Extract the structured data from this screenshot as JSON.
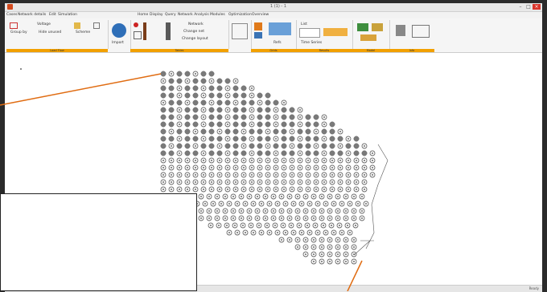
{
  "window": {
    "title": "1 (1) - 1",
    "minimize_icon": "minimize-icon",
    "maximize_icon": "maximize-icon",
    "close_icon": "close-icon"
  },
  "menu": [
    {
      "label": "Cases"
    },
    {
      "label": "Network details"
    },
    {
      "label": "Edit"
    },
    {
      "label": "Simulation"
    },
    {
      "label": "Home"
    },
    {
      "label": "Display"
    },
    {
      "label": "Query"
    },
    {
      "label": "Network Analysis"
    },
    {
      "label": "Modules"
    },
    {
      "label": "Optimization"
    },
    {
      "label": "Overview"
    }
  ],
  "ribbon": {
    "toolbar1": {
      "label1": "Voltage",
      "label2": "Group by",
      "label3": "Hide unused",
      "label4": "Scheme"
    },
    "import_label": "Import",
    "groups": [
      {
        "label": "Load Flow",
        "color": "#f2a000"
      },
      {
        "label": "Tables",
        "color": "#f2a000"
      },
      {
        "label": "Grids",
        "color": "#f2a000"
      },
      {
        "label": "Results",
        "color": "#f2a000"
      },
      {
        "label": "Model",
        "color": "#f2a000"
      },
      {
        "label": "Info",
        "color": "#f2a000"
      }
    ],
    "buttons": {
      "network_label": "Network",
      "change_label": "Change net",
      "change_layout_label": "Change layout",
      "refs_label": "Refs",
      "list_label": "List",
      "time_label": "Time Series"
    }
  },
  "status": {
    "text": "Ready"
  },
  "colors": {
    "accent": "#f2a000",
    "callout": "#e06c12",
    "node": "#7a7a7a",
    "close": "#d9352b"
  }
}
